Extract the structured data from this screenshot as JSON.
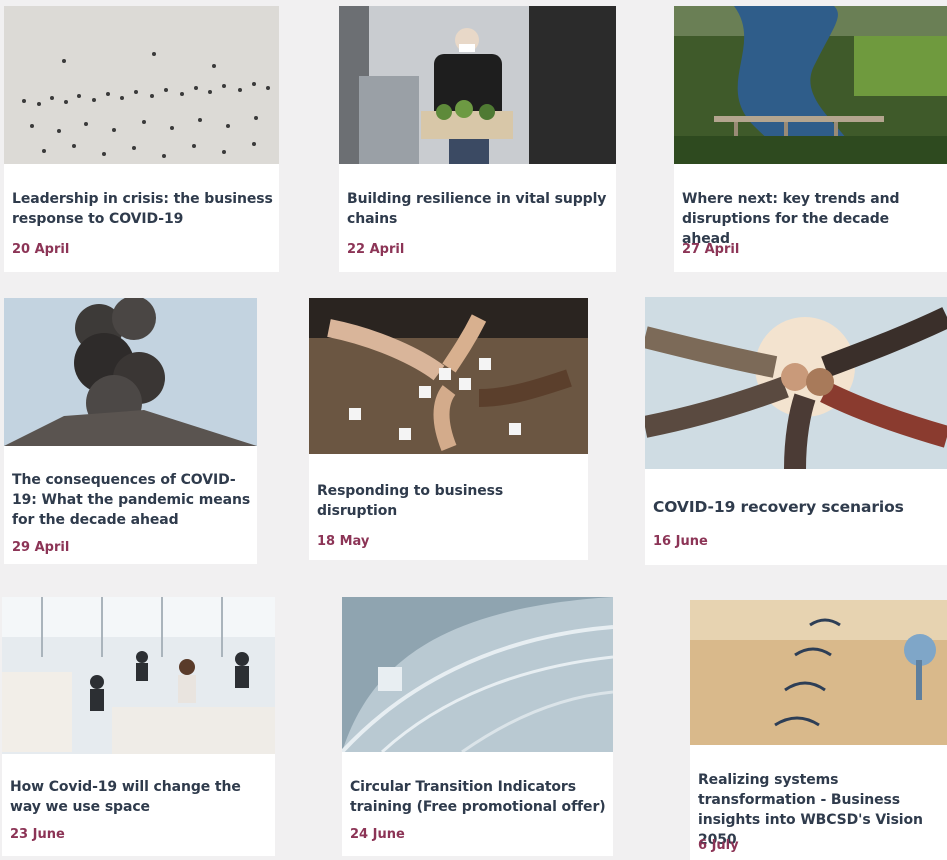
{
  "cards": [
    {
      "title": "Leadership in crisis: the business response to COVID-19",
      "date": "20 April",
      "image": "crowd-aerial-image"
    },
    {
      "title": "Building resilience in vital supply chains",
      "date": "22 April",
      "image": "delivery-person-image"
    },
    {
      "title": "Where next: key trends and disruptions for the decade ahead",
      "date": "27 April",
      "image": "river-bridge-image"
    },
    {
      "title": "The consequences of COVID-19: What the pandemic means for the decade ahead",
      "date": "29 April",
      "image": "volcano-smoke-image"
    },
    {
      "title": "Responding to business disruption",
      "date": "18 May",
      "image": "puzzle-hands-image"
    },
    {
      "title": "COVID-19 recovery scenarios",
      "date": "16 June",
      "image": "team-hands-circle-image"
    },
    {
      "title": "How Covid-19 will change the way we use space",
      "date": "23 June",
      "image": "open-office-image"
    },
    {
      "title": "Circular Transition Indicators training (Free promotional offer)",
      "date": "24 June",
      "image": "curved-architecture-image"
    },
    {
      "title": "Realizing systems transformation - Business insights into WBCSD's Vision 2050",
      "date": "6 July",
      "image": "year-dial-2050-image"
    }
  ],
  "colors": {
    "background": "#f1f0f1",
    "card": "#ffffff",
    "title": "#2f3b4c",
    "date": "#8c3456"
  }
}
